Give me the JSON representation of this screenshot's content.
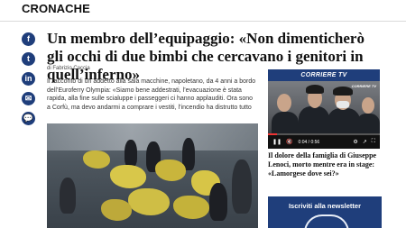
{
  "section": {
    "label": "CRONACHE"
  },
  "social": [
    {
      "name": "facebook",
      "glyph": "f"
    },
    {
      "name": "twitter",
      "glyph": "t"
    },
    {
      "name": "linkedin",
      "glyph": "in"
    },
    {
      "name": "email",
      "glyph": "✉"
    },
    {
      "name": "comments",
      "glyph": "💬"
    }
  ],
  "article": {
    "headline": "Un membro dell’equipaggio: «Non dimenticherò gli occhi di due bimbi che cercavano i genitori in quell’inferno»",
    "byline": "di Fabrizio Caccia",
    "lead": "Il racconto di un addetto alla sala macchine, napoletano, da 4 anni a bordo dell’Euroferry Olympia: «Siamo bene addestrati, l’evacuazione è stata rapida, alla fine sulle scialuppe i passeggeri ci hanno applauditi. Ora sono a Corfù, ma devo andarmi a comprare i vestiti, l’incendio ha distrutto tutto"
  },
  "video": {
    "brand": "CORRIERE TV",
    "watermark": "CORRIERE TV",
    "time": "0:04 / 0:56",
    "progress": 0.08,
    "caption": "Il dolore della famiglia di Giuseppe Lenoci, morto mentre era in stage: «Lamorgese dove sei?»"
  },
  "newsletter": {
    "title": "Iscriviti alla newsletter"
  },
  "colors": {
    "brand_blue": "#1f3e7b"
  }
}
